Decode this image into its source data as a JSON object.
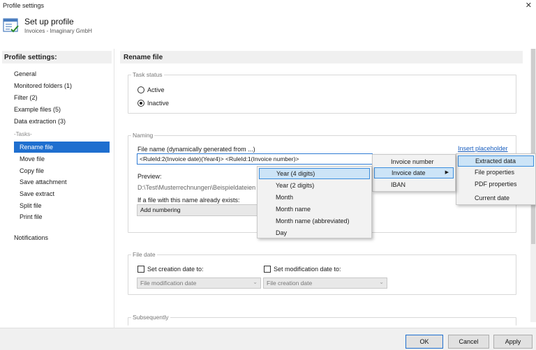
{
  "window": {
    "title": "Profile settings",
    "close_glyph": "✕"
  },
  "header": {
    "title": "Set up profile",
    "subtitle": "Invoices - Imaginary GmbH",
    "icon": "profile-icon"
  },
  "left": {
    "heading": "Profile settings:",
    "items": [
      "General",
      "Monitored folders (1)",
      "Filter (2)",
      "Example files (5)",
      "Data extraction (3)"
    ],
    "tasks_label": "-Tasks-",
    "tasks": [
      "Rename file",
      "Move file",
      "Copy file",
      "Save attachment",
      "Save extract",
      "Split file",
      "Print file"
    ],
    "selected_task": "Rename file",
    "notifications": "Notifications"
  },
  "right": {
    "heading": "Rename file",
    "task_status": {
      "label": "Task status",
      "active": "Active",
      "inactive": "Inactive",
      "selected": "Inactive"
    },
    "naming": {
      "label": "Naming",
      "file_name_label": "File name (dynamically generated from ...)",
      "insert_placeholder": "Insert placeholder",
      "file_name_value": "<RuleId:2(Invoice date)(Year4)> <RuleId:1(Invoice number)>",
      "preview_label": "Preview:",
      "preview_value": "D:\\Test\\Musterrechnungen\\Beispieldateien",
      "exists_label": "If a file with this name already exists:",
      "exists_value": "Add numbering"
    },
    "file_date": {
      "label": "File date",
      "creation_label": "Set creation date to:",
      "modification_label": "Set modification date to:",
      "creation_value": "File modification date",
      "modification_value": "File creation date"
    },
    "subsequently": {
      "label": "Subsequently"
    }
  },
  "menus": {
    "placeholder_menu": [
      {
        "label": "Extracted data",
        "has_sub": true,
        "highlight": true
      },
      {
        "label": "File properties",
        "has_sub": true
      },
      {
        "label": "PDF properties",
        "has_sub": true
      },
      {
        "label": "Current date",
        "has_sub": true
      }
    ],
    "extracted_menu": [
      {
        "label": "Invoice number",
        "has_sub": false
      },
      {
        "label": "Invoice date",
        "has_sub": true,
        "highlight": true
      },
      {
        "label": "IBAN",
        "has_sub": false
      }
    ],
    "date_menu": [
      {
        "label": "Year (4 digits)",
        "highlight": true
      },
      {
        "label": "Year (2 digits)"
      },
      {
        "label": "Month"
      },
      {
        "label": "Month name"
      },
      {
        "label": "Month name (abbreviated)"
      },
      {
        "label": "Day"
      }
    ]
  },
  "footer": {
    "ok": "OK",
    "cancel": "Cancel",
    "apply": "Apply"
  },
  "colors": {
    "accent": "#1f6fcf",
    "highlight": "#cce4f7",
    "link": "#1a5fbf"
  }
}
